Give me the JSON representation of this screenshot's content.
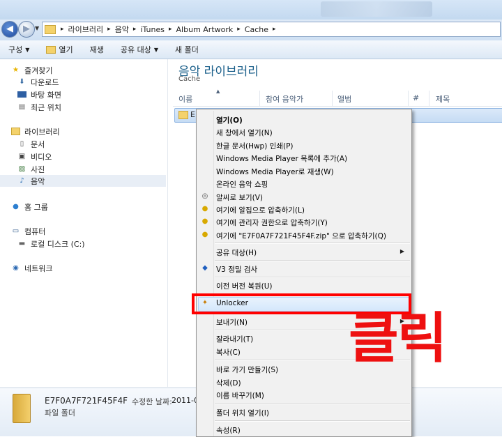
{
  "address": {
    "crumbs": [
      "라이브러리",
      "음악",
      "iTunes",
      "Album Artwork",
      "Cache"
    ]
  },
  "toolbar": {
    "organize": "구성",
    "open": "열기",
    "play": "재생",
    "share": "공유 대상",
    "new_folder": "새 폴더"
  },
  "sidebar": {
    "favorites": "즐겨찾기",
    "downloads": "다운로드",
    "desktop": "바탕 화면",
    "recent": "최근 위치",
    "libraries": "라이브러리",
    "documents": "문서",
    "videos": "비디오",
    "pictures": "사진",
    "music": "음악",
    "homegroup": "홈 그룹",
    "computer": "컴퓨터",
    "local_disk": "로컬 디스크 (C:)",
    "network": "네트워크"
  },
  "content": {
    "title": "음악 라이브러리",
    "subtitle": "Cache",
    "columns": [
      "이름",
      "참여 음악가",
      "앨범",
      "#",
      "제목"
    ],
    "file_name": "E7"
  },
  "context_menu": {
    "items": [
      "열기(O)",
      "새 창에서 열기(N)",
      "한글 문서(Hwp) 인쇄(P)",
      "Windows Media Player 목록에 추가(A)",
      "Windows Media Player로 재생(W)",
      "온라인 음악 쇼핑",
      "알씨로 보기(V)",
      "여기에 알집으로 압축하기(L)",
      "여기에 관리자 권한으로 압축하기(Y)",
      "여기에 \"E7F0A7F721F45F4F.zip\" 으로 압축하기(Q)",
      "공유 대상(H)",
      "V3 정밀 검사",
      "이전 버전 복원(U)",
      "Unlocker",
      "보내기(N)",
      "잘라내기(T)",
      "복사(C)",
      "바로 가기 만들기(S)",
      "삭제(D)",
      "이름 바꾸기(M)",
      "폴더 위치 열기(I)",
      "속성(R)"
    ]
  },
  "details": {
    "name": "E7F0A7F721F45F4F",
    "date_label": "수정한 날짜:",
    "date": "2011-05-03",
    "type": "파일 폴더"
  },
  "annotation": {
    "click_text": "클릭",
    "color": "#ee1010"
  }
}
